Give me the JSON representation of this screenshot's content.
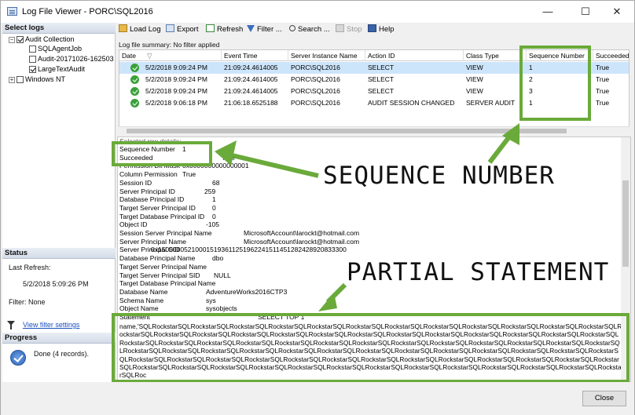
{
  "window": {
    "title": "Log File Viewer - PORC\\SQL2016",
    "minimize": "—",
    "maximize": "☐",
    "close": "✕"
  },
  "left": {
    "select_logs_header": "Select logs",
    "tree": [
      {
        "label": "Audit Collection",
        "checked": true,
        "expander": "−"
      },
      {
        "label": "SQLAgentJob",
        "checked": false
      },
      {
        "label": "Audit-20171026-162503",
        "checked": false
      },
      {
        "label": "LargeTextAudit",
        "checked": true
      },
      {
        "label": "Windows NT",
        "checked": false,
        "expander": "+"
      }
    ],
    "status_header": "Status",
    "last_refresh_label": "Last Refresh:",
    "last_refresh_value": "5/2/2018 5:09:26 PM",
    "filter_label": "Filter: None",
    "view_filter_link": "View filter settings",
    "progress_header": "Progress",
    "progress_text": "Done (4 records)."
  },
  "toolbar": {
    "load_log": "Load Log",
    "export": "Export",
    "refresh": "Refresh",
    "filter": "Filter ...",
    "search": "Search ...",
    "stop": "Stop",
    "help": "Help"
  },
  "grid": {
    "summary": "Log file summary: No filter applied",
    "columns": [
      "Date",
      "Event Time",
      "Server Instance Name",
      "Action ID",
      "Class Type",
      "Sequence Number",
      "Succeeded"
    ],
    "rows": [
      [
        "5/2/2018 9:09:24 PM",
        "21:09:24.4614005",
        "PORC\\SQL2016",
        "SELECT",
        "VIEW",
        "1",
        "True"
      ],
      [
        "5/2/2018 9:09:24 PM",
        "21:09:24.4614005",
        "PORC\\SQL2016",
        "SELECT",
        "VIEW",
        "2",
        "True"
      ],
      [
        "5/2/2018 9:09:24 PM",
        "21:09:24.4614005",
        "PORC\\SQL2016",
        "SELECT",
        "VIEW",
        "3",
        "True"
      ],
      [
        "5/2/2018 9:06:18 PM",
        "21:06:18.6525188",
        "PORC\\SQL2016",
        "AUDIT SESSION CHANGED",
        "SERVER AUDIT",
        "1",
        "True"
      ]
    ]
  },
  "details": {
    "header": "Selected row details:",
    "fields": [
      [
        "Sequence Number",
        "1"
      ],
      [
        "Succeeded",
        "True"
      ],
      [
        "Permission Bit Mask",
        "0x0000000000000001"
      ],
      [
        "Column Permission",
        "True"
      ],
      [
        "Session ID",
        "68"
      ],
      [
        "Server Principal ID",
        "259"
      ],
      [
        "Database Principal ID",
        "1"
      ],
      [
        "Target Server Principal ID",
        "0"
      ],
      [
        "Target Database Principal ID",
        "0"
      ],
      [
        "Object ID",
        "-105"
      ],
      [
        "Session Server Principal Name",
        "MicrosoftAccount\\larockt@hotmail.com"
      ],
      [
        "Server Principal Name",
        "MicrosoftAccount\\larockt@hotmail.com"
      ],
      [
        "Server Principal SID",
        "0x150000052100015193611251962241511451282428920833300"
      ],
      [
        "Database Principal Name",
        "dbo"
      ],
      [
        "Target Server Principal Name",
        ""
      ],
      [
        "Target Server Principal SID",
        "NULL"
      ],
      [
        "Target Database Principal Name",
        ""
      ],
      [
        "Database Name",
        "AdventureWorks2016CTP3"
      ],
      [
        "Schema Name",
        "sys"
      ],
      [
        "Object Name",
        "sysobjects"
      ],
      [
        "Statement",
        "SELECT TOP 1"
      ]
    ],
    "statement_text": "name,'SQLRockstarSQLRockstarSQLRockstarSQLRockstarSQLRockstarSQLRockstarSQLRockstarSQLRockstarSQLRockstarSQLRockstarSQLRockstarSQLRockstarSQLRockstarSQLRockstarSQLRockstarSQLRockstarSQLRockstarSQLRockstarSQLRockstarSQLRockstarSQLRockstarSQLRockstarSQLRockstarSQLRockstarSQLRockstarSQLRockstarSQLRockstarSQLRockstarSQLRockstarSQLRockstarSQLRockstarSQLRockstarSQLRockstarSQLRockstarSQLRockstarSQLRockstarSQLRockstarSQLRockstarSQLRockstarSQLRockstarSQLRockstarSQLRockstarSQLRockstarSQLRockstarSQLRockstarSQLRockstarSQLRockstarSQLRockstarSQLRockstarSQLRockstarSQLRockstarSQLRockstarSQLRockstarSQLRockstarSQLRockstarSQLRockstarSQLRockstarSQLRockstarSQLRockstarSQLRockstarSQLRockstarSQLRockstarSQLRockstarSQLRockstarSQLRockstarSQLRockstarSQLRockstarSQLRockstarSQLRockstarSQLRockstarSQLRockstarSQLRockstarSQLRockstarSQLRockstarSQLRockstarSQLRockstarSQLRockstarSQLRoc"
  },
  "annotations": {
    "sequence_number": "SEQUENCE NUMBER",
    "partial_statement": "PARTIAL STATEMENT",
    "color": "#6aaa3a"
  },
  "footer": {
    "close": "Close"
  }
}
